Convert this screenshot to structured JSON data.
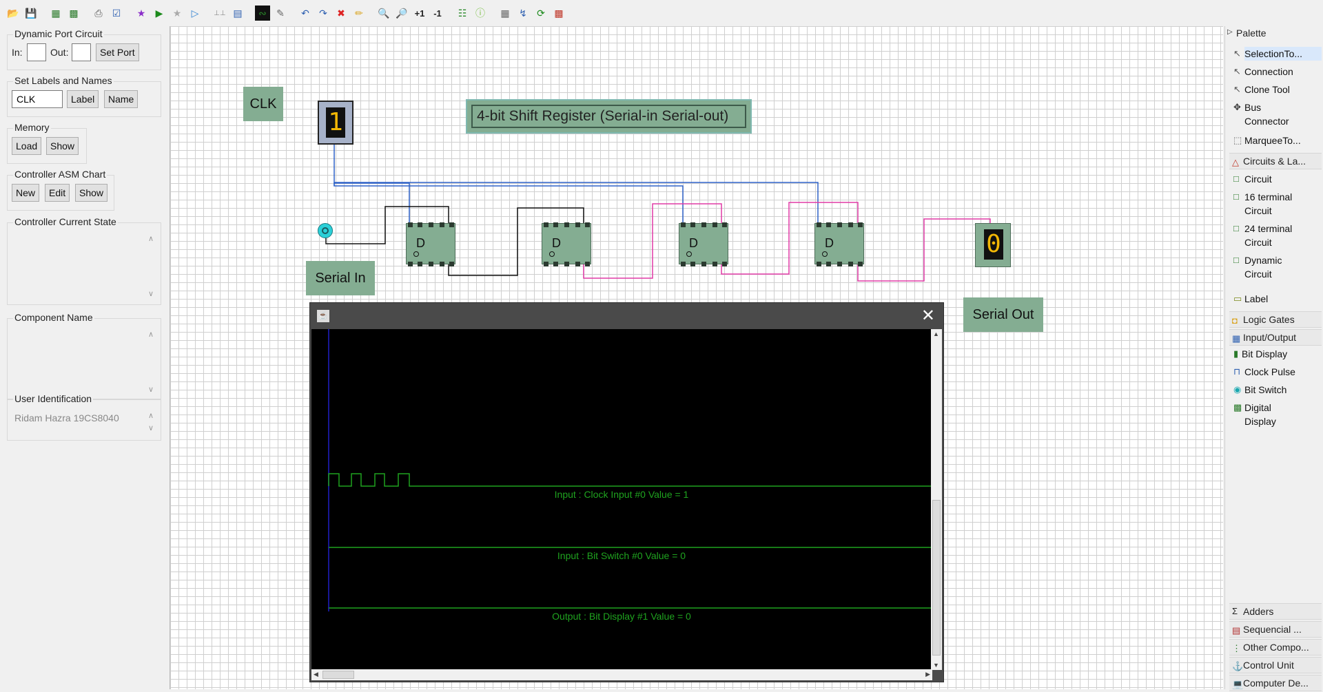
{
  "toolbar": {
    "icons": [
      "open-icon",
      "save-icon",
      "export-icon",
      "save-as-icon",
      "print-icon",
      "verify-icon",
      "star-icon",
      "run-icon",
      "star-gray-icon",
      "step-icon",
      "timing-icon",
      "bar-icon",
      "waveform-icon",
      "edit-icon",
      "undo-icon",
      "redo-icon",
      "delete-icon",
      "paint-icon",
      "zoom-in-icon",
      "zoom-out-icon",
      "inc-icon",
      "dec-icon",
      "wire-icon",
      "info-icon",
      "grid-icon",
      "connect-icon",
      "refresh-icon",
      "palette-icon"
    ],
    "inc_label": "+1",
    "dec_label": "-1"
  },
  "left_panel": {
    "dynamic_port": {
      "title": "Dynamic Port Circuit",
      "in_label": "In:",
      "in_value": "",
      "out_label": "Out:",
      "out_value": "",
      "set_port": "Set Port"
    },
    "labels_names": {
      "title": "Set Labels and Names",
      "value": "CLK",
      "label_btn": "Label",
      "name_btn": "Name"
    },
    "memory": {
      "title": "Memory",
      "load": "Load",
      "show": "Show"
    },
    "asm_chart": {
      "title": "Controller ASM Chart",
      "new": "New",
      "edit": "Edit",
      "show": "Show"
    },
    "current_state": {
      "title": "Controller Current State"
    },
    "component_name": {
      "title": "Component Name"
    },
    "user_id": {
      "title": "User Identification",
      "value": "Ridam Hazra 19CS8040"
    }
  },
  "canvas": {
    "clk_label": "CLK",
    "clock_value": "1",
    "title": "4-bit Shift Register (Serial-in Serial-out)",
    "serial_in": "Serial In",
    "serial_out": "Serial Out",
    "output_value": "0",
    "ff_label": "D"
  },
  "waveform": {
    "signals": [
      "Input : Clock Input #0  Value = 1",
      "Input : Bit Switch #0 Value = 0",
      "Output : Bit Display #1 Value = 0"
    ],
    "close": "✕"
  },
  "palette": {
    "title": "Palette",
    "tools": [
      "SelectionTo...",
      "Connection",
      "Clone Tool",
      "Bus Connector",
      "MarqueeTo..."
    ],
    "circuits_cat": "Circuits & La...",
    "circuits": [
      "Circuit",
      "16 terminal Circuit",
      "24 terminal Circuit",
      "Dynamic Circuit",
      "Label"
    ],
    "logic_gates": "Logic Gates",
    "io_cat": "Input/Output",
    "io_items": [
      "Bit Display",
      "Clock Pulse",
      "Bit Switch",
      "Digital Display"
    ],
    "bottom_cats": [
      "Adders",
      "Sequencial ...",
      "Other Compo...",
      "Control Unit",
      "Computer De..."
    ]
  },
  "colors": {
    "component_green": "#84ad92",
    "wire_blue": "#2e62c8",
    "wire_pink": "#e03aa6",
    "wave_green": "#1fa31f"
  }
}
